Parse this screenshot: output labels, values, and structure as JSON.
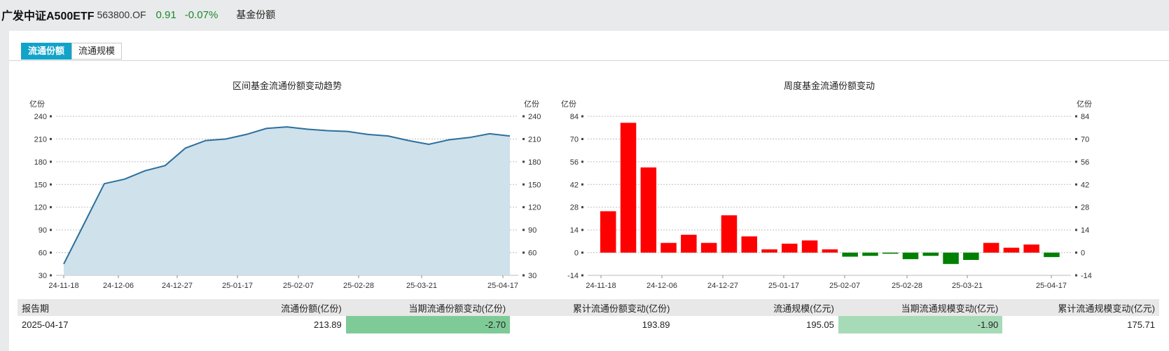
{
  "header": {
    "name": "广发中证A500ETF",
    "code": "563800.OF",
    "price": "0.91",
    "change": "-0.07%",
    "section": "基金份额"
  },
  "tabs": [
    {
      "label": "流通份额",
      "active": true
    },
    {
      "label": "流通规模",
      "active": false
    }
  ],
  "colors": {
    "area_fill": "#cfe1ea",
    "line": "#2b6f9d",
    "positive": "#ff0000",
    "negative": "#008000",
    "tab_active": "#12a3c9"
  },
  "chart_data": [
    {
      "type": "area",
      "title": "区间基金流通份额变动趋势",
      "ylabel": "亿份",
      "ylabel_right": "亿份",
      "ylim": [
        30,
        240
      ],
      "yticks": [
        30,
        60,
        90,
        120,
        150,
        180,
        210,
        240
      ],
      "xtick_labels": [
        "24-11-18",
        "24-12-06",
        "24-12-27",
        "25-01-17",
        "25-02-07",
        "25-02-28",
        "25-03-21",
        "25-04-17"
      ],
      "grid": true,
      "x": [
        "24-11-18",
        "24-11-22",
        "24-11-29",
        "24-12-06",
        "24-12-13",
        "24-12-20",
        "24-12-27",
        "25-01-03",
        "25-01-10",
        "25-01-17",
        "25-01-24",
        "25-01-31",
        "25-02-07",
        "25-02-14",
        "25-02-21",
        "25-02-28",
        "25-03-07",
        "25-03-14",
        "25-03-21",
        "25-03-28",
        "25-04-03",
        "25-04-11",
        "25-04-17"
      ],
      "values": [
        45,
        98,
        151,
        157,
        168,
        175,
        198,
        208,
        210,
        216,
        224,
        226,
        223,
        221,
        220,
        216,
        214,
        208,
        203,
        209,
        212,
        217,
        214
      ]
    },
    {
      "type": "bar",
      "title": "周度基金流通份额变动",
      "ylabel": "亿份",
      "ylabel_right": "亿份",
      "ylim": [
        -14,
        84
      ],
      "yticks": [
        -14,
        0,
        14,
        28,
        42,
        56,
        70,
        84
      ],
      "xtick_labels": [
        "24-11-18",
        "24-12-06",
        "24-12-27",
        "25-01-17",
        "25-02-07",
        "25-02-28",
        "25-03-21",
        "25-04-17"
      ],
      "grid": true,
      "values": [
        25.5,
        80,
        52.5,
        6,
        11,
        6,
        23,
        10,
        2,
        5.5,
        7.5,
        2,
        -2.5,
        -2,
        -0.7,
        -4,
        -2,
        -7,
        -4.5,
        6,
        3,
        5,
        -2.7
      ]
    }
  ],
  "table": {
    "headers": [
      "报告期",
      "流通份额(亿份)",
      "当期流通份额变动(亿份)",
      "累计流通份额变动(亿份)",
      "流通规模(亿元)",
      "当期流通规模变动(亿元)",
      "累计流通规模变动(亿元)"
    ],
    "rows": [
      [
        "2025-04-17",
        "213.89",
        "-2.70",
        "193.89",
        "195.05",
        "-1.90",
        "175.71"
      ]
    ]
  }
}
